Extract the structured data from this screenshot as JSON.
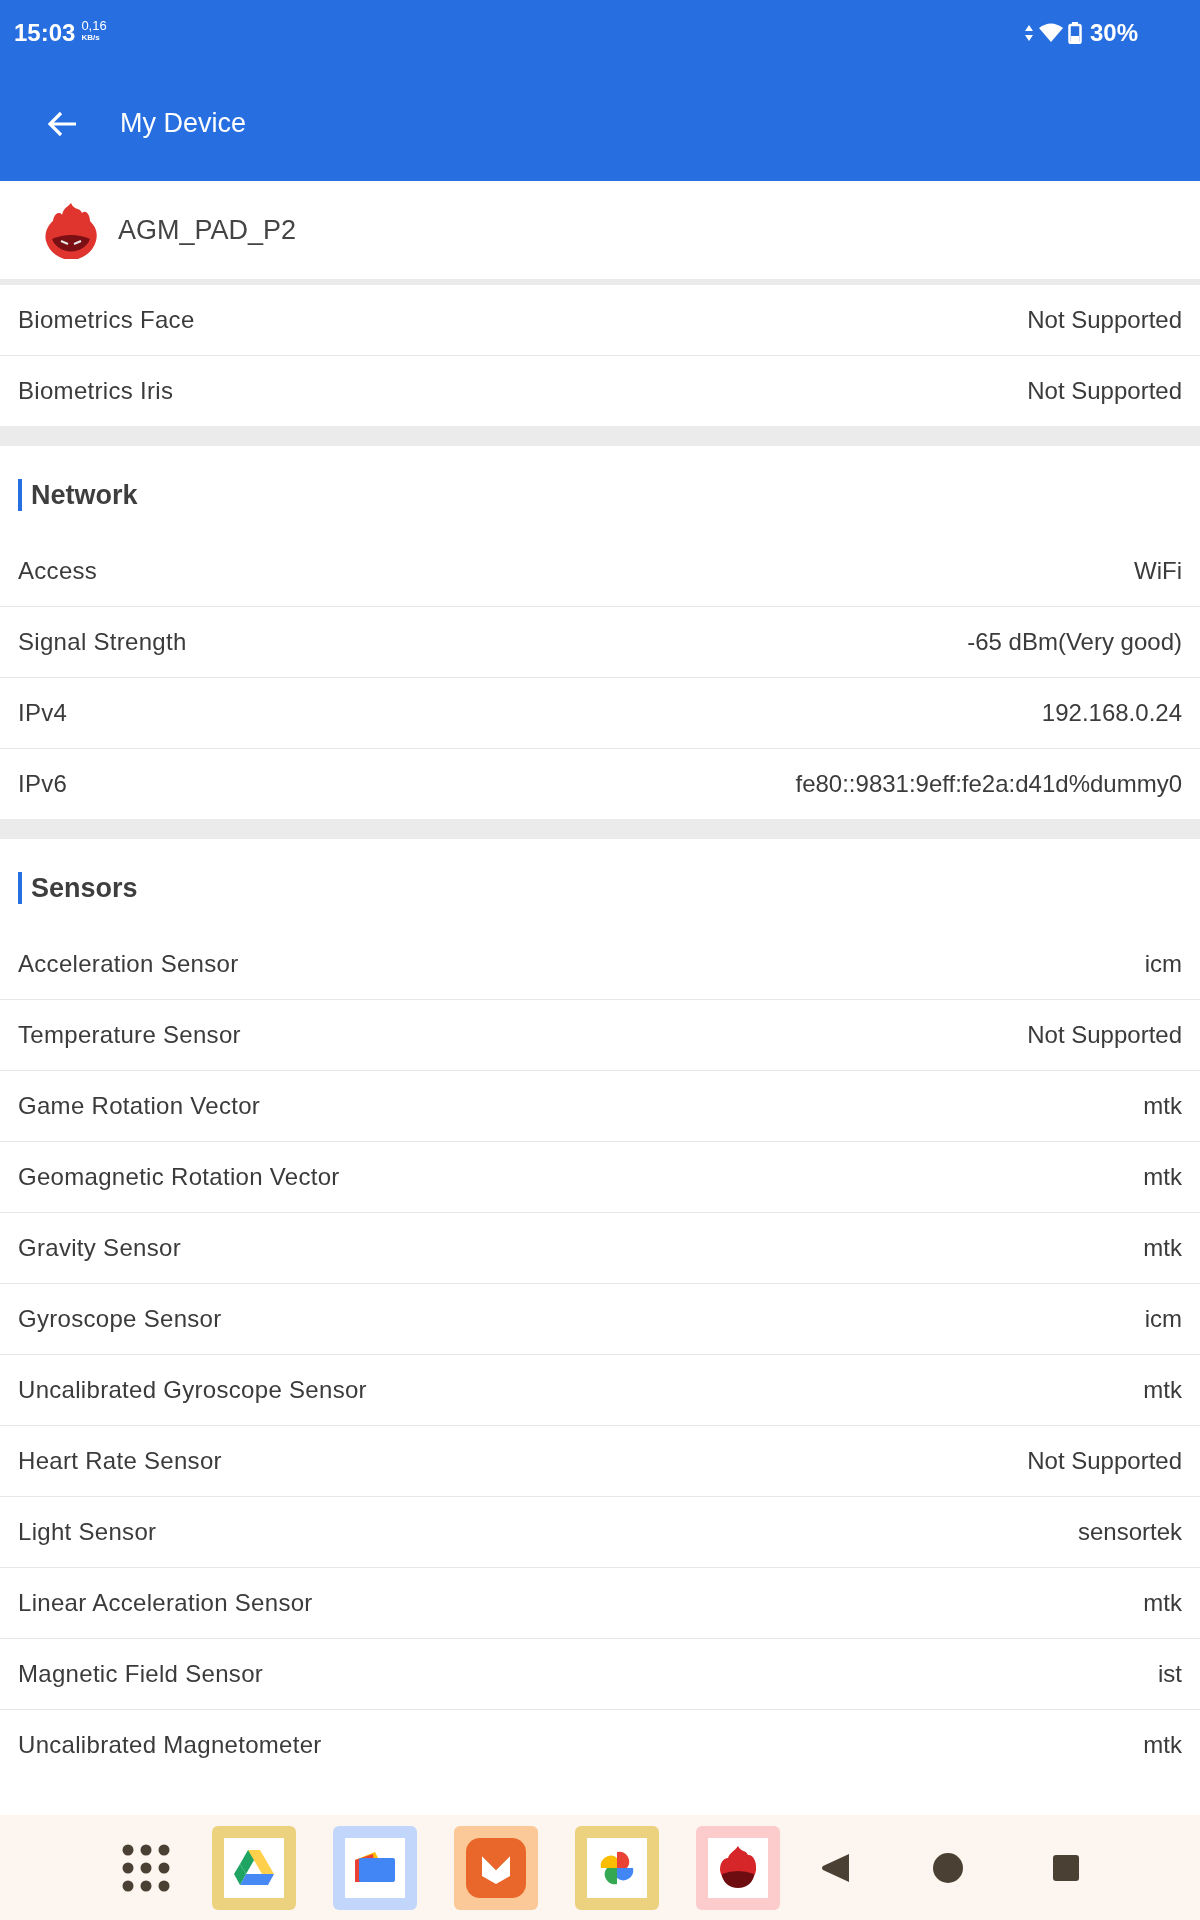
{
  "status_bar": {
    "time": "15:03",
    "speed": "0,16",
    "speed_unit": "KB/s",
    "battery": "30%"
  },
  "toolbar": {
    "title": "My Device"
  },
  "device": {
    "name": "AGM_PAD_P2"
  },
  "groups": [
    {
      "rows": [
        {
          "label": "Biometrics Face",
          "value": "Not Supported"
        },
        {
          "label": "Biometrics Iris",
          "value": "Not Supported"
        }
      ]
    },
    {
      "title": "Network",
      "rows": [
        {
          "label": "Access",
          "value": "WiFi"
        },
        {
          "label": "Signal Strength",
          "value": "-65 dBm(Very good)"
        },
        {
          "label": "IPv4",
          "value": "192.168.0.24"
        },
        {
          "label": "IPv6",
          "value": "fe80::9831:9eff:fe2a:d41d%dummy0"
        }
      ]
    },
    {
      "title": "Sensors",
      "rows": [
        {
          "label": "Acceleration Sensor",
          "value": "icm"
        },
        {
          "label": "Temperature Sensor",
          "value": "Not Supported"
        },
        {
          "label": "Game Rotation Vector",
          "value": "mtk"
        },
        {
          "label": "Geomagnetic Rotation Vector",
          "value": "mtk"
        },
        {
          "label": "Gravity Sensor",
          "value": "mtk"
        },
        {
          "label": "Gyroscope Sensor",
          "value": "icm"
        },
        {
          "label": "Uncalibrated Gyroscope Sensor",
          "value": "mtk"
        },
        {
          "label": "Heart Rate Sensor",
          "value": "Not Supported"
        },
        {
          "label": "Light Sensor",
          "value": "sensortek"
        },
        {
          "label": "Linear Acceleration Sensor",
          "value": "mtk"
        },
        {
          "label": "Magnetic Field Sensor",
          "value": "ist"
        },
        {
          "label": "Uncalibrated Magnetometer",
          "value": "mtk"
        }
      ]
    }
  ],
  "dock": {
    "apps": [
      {
        "kind": "drive"
      },
      {
        "kind": "files"
      },
      {
        "kind": "store"
      },
      {
        "kind": "photos"
      },
      {
        "kind": "antutu"
      }
    ]
  }
}
